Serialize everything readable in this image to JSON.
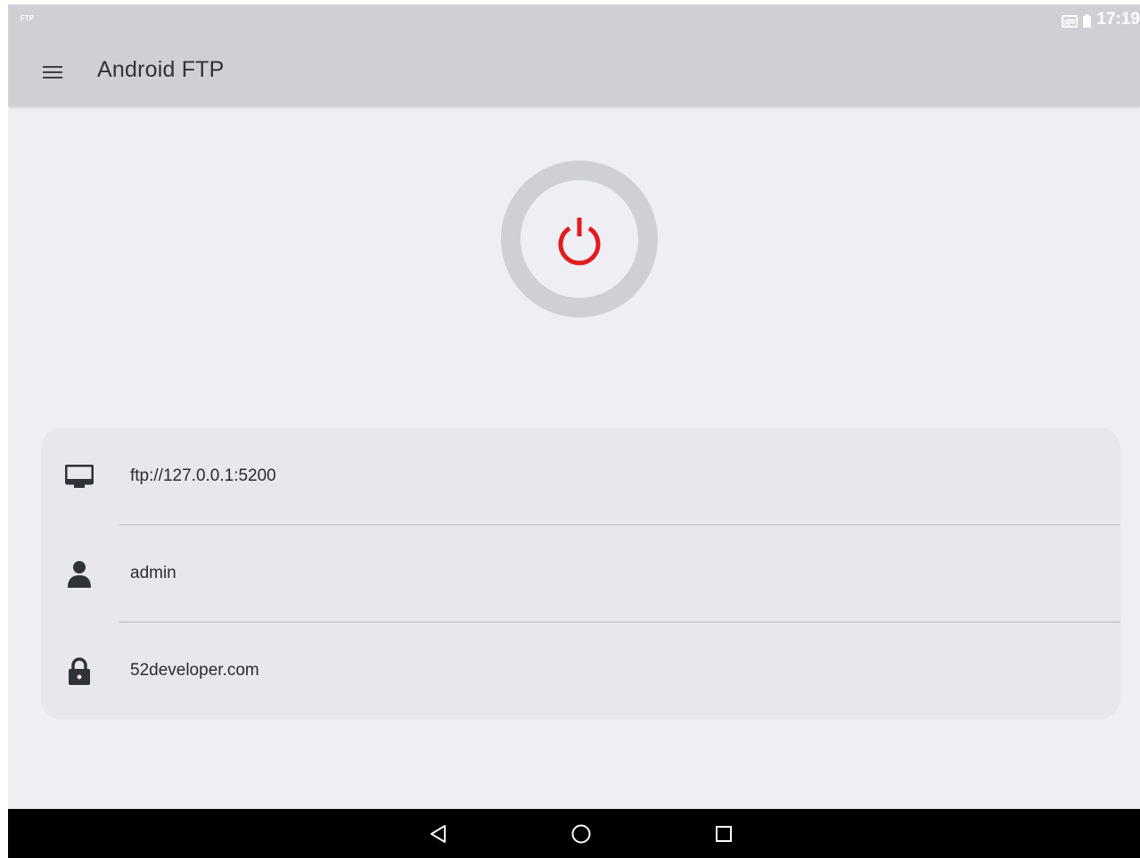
{
  "status_bar": {
    "app_label": "FTP",
    "time": "17:19",
    "icons": [
      "cast-icon",
      "battery-icon"
    ]
  },
  "toolbar": {
    "title": "Android FTP",
    "menu_icon": "menu-icon"
  },
  "power_button": {
    "icon": "power-icon",
    "color": "#e21b1b"
  },
  "info": {
    "rows": [
      {
        "icon": "monitor-icon",
        "value": "ftp://127.0.0.1:5200"
      },
      {
        "icon": "person-icon",
        "value": "admin"
      },
      {
        "icon": "lock-icon",
        "value": "52developer.com"
      }
    ]
  },
  "nav_bar": {
    "buttons": [
      "back-icon",
      "home-icon",
      "recents-icon"
    ]
  }
}
